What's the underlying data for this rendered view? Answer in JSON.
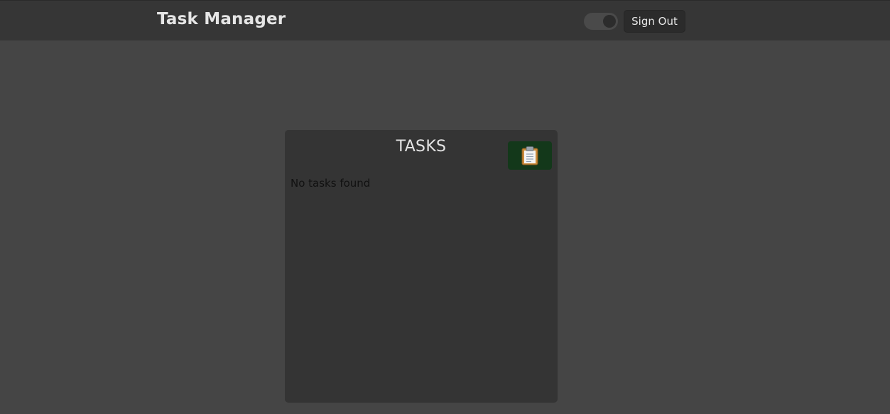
{
  "header": {
    "app_title": "Task Manager",
    "signout_label": "Sign Out",
    "theme_toggle_state": "off"
  },
  "tasks": {
    "title": "TASKS",
    "add_button_icon": "clipboard-icon",
    "empty_message": "No tasks found",
    "items": []
  },
  "colors": {
    "page_background": "#454545",
    "header_background": "#363636",
    "panel_background": "#343434",
    "add_button_background": "#13381a"
  }
}
